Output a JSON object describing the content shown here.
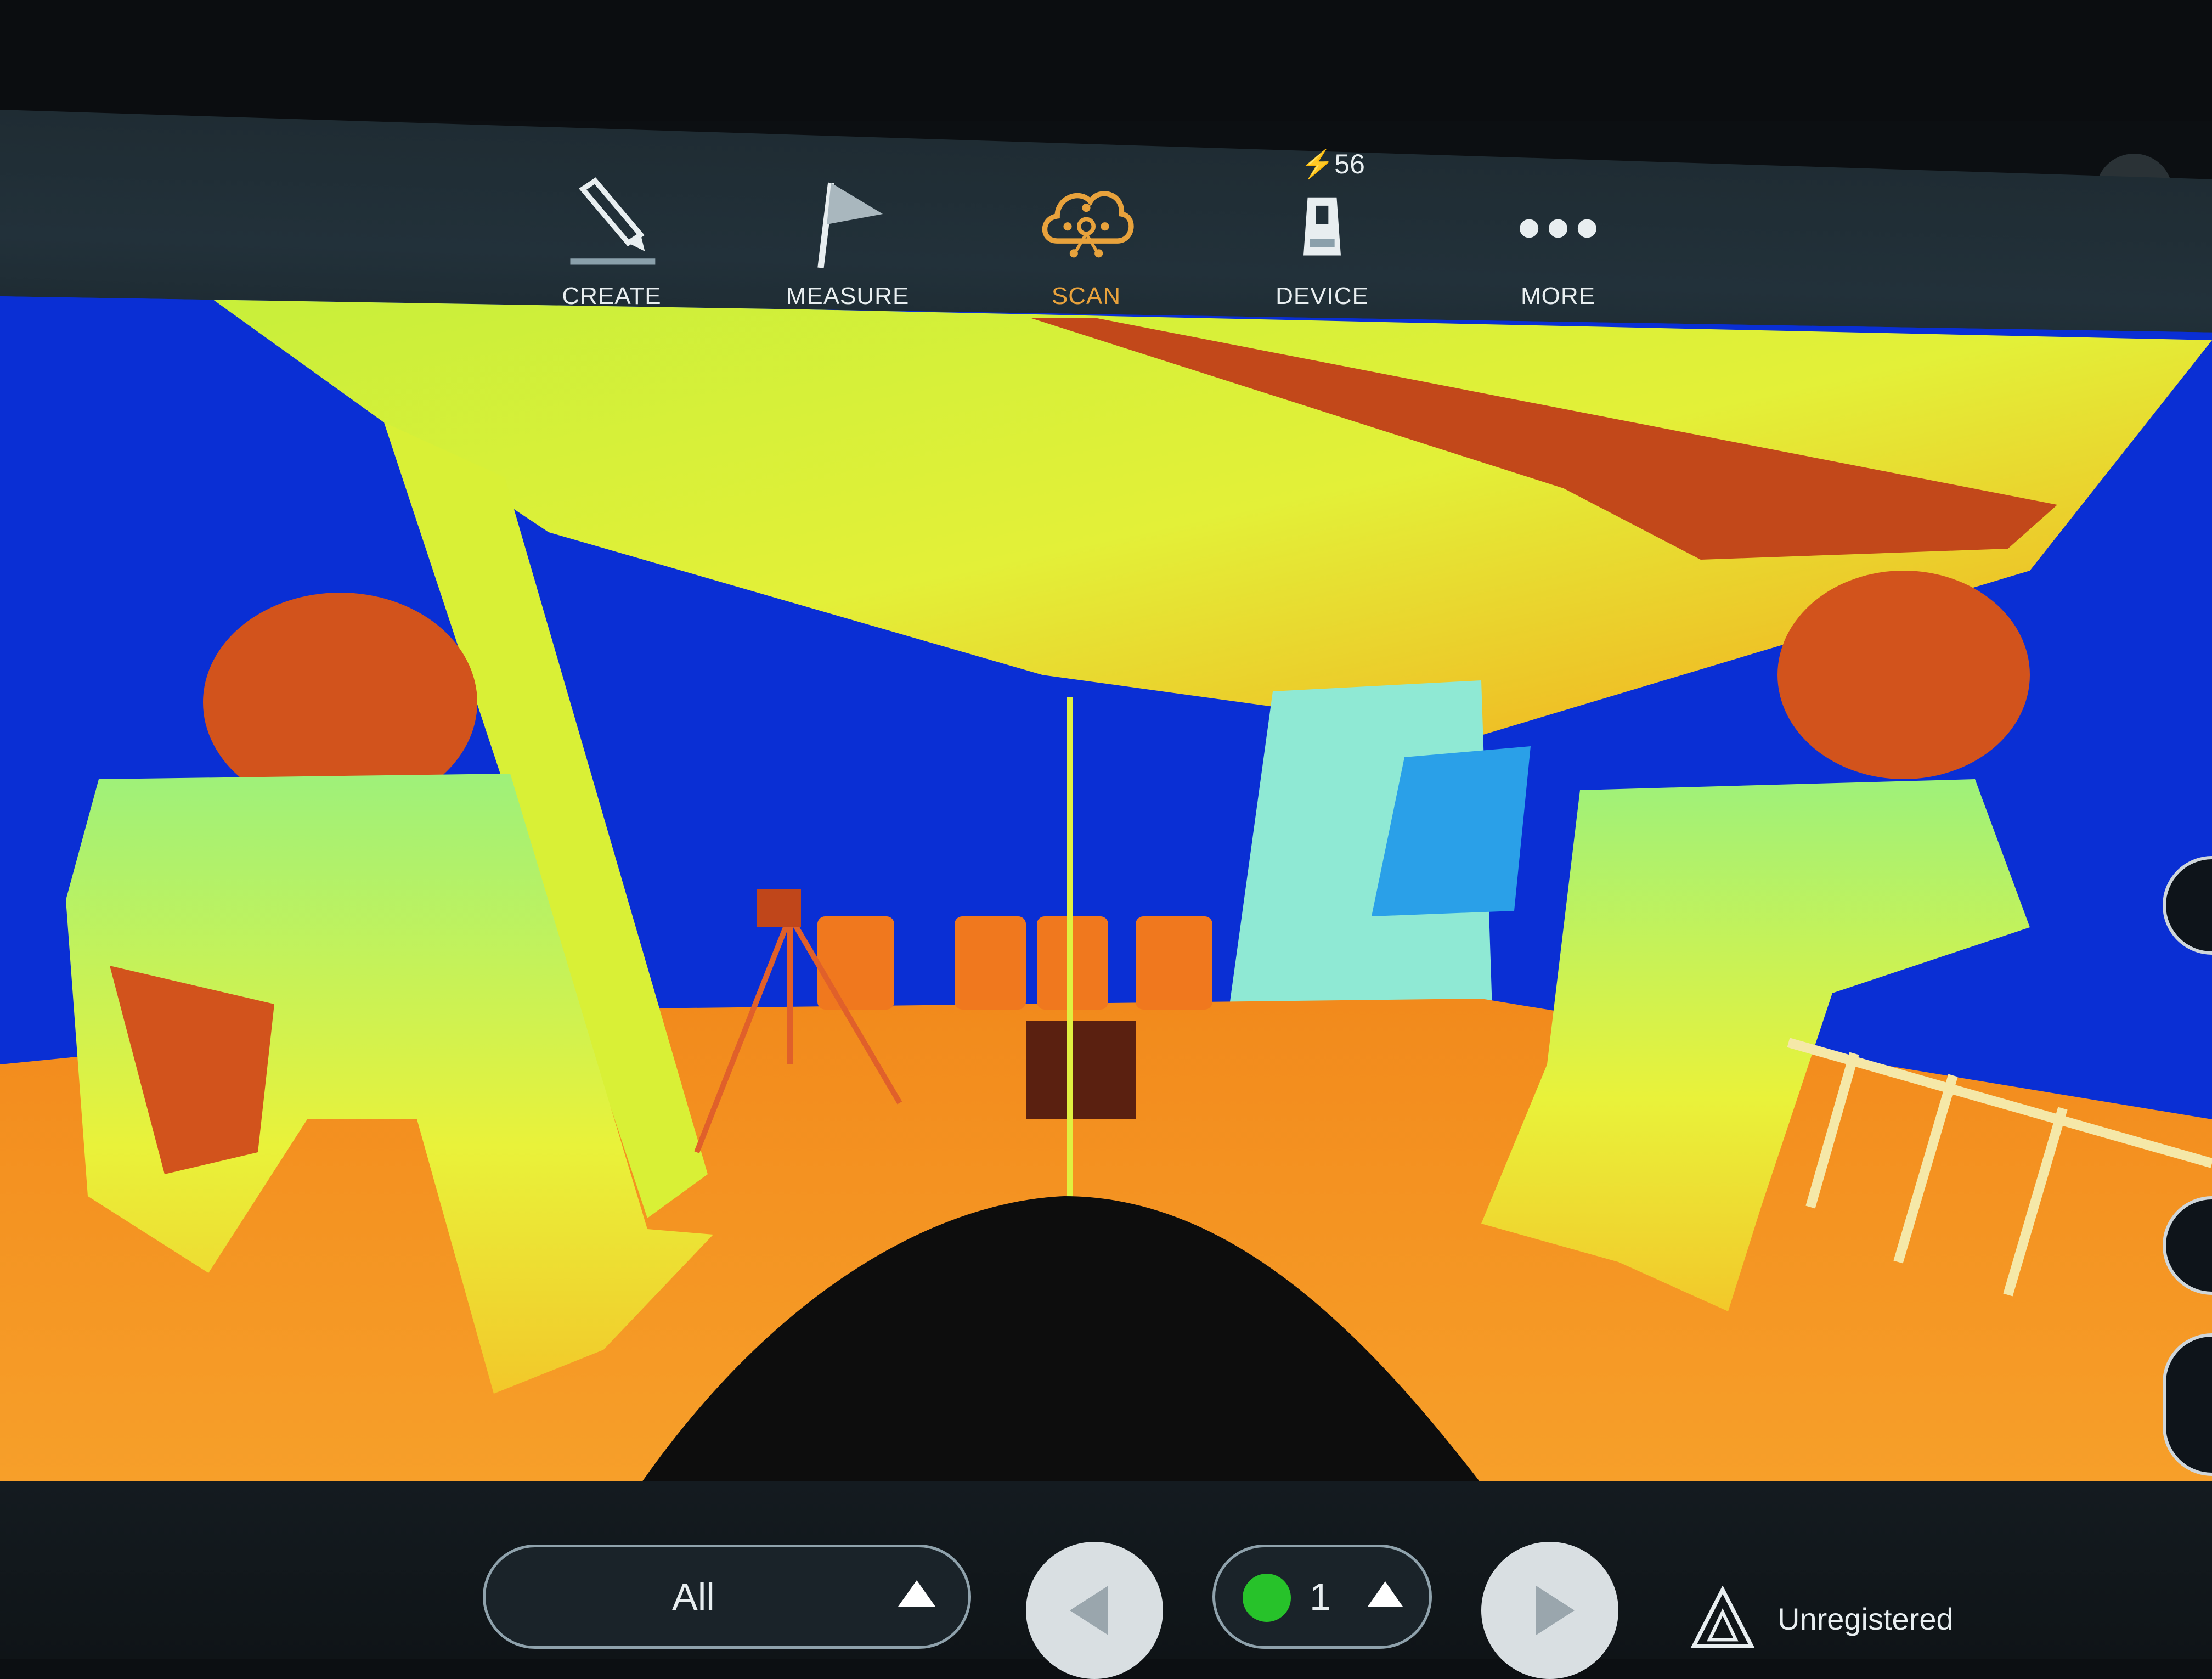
{
  "toolbar": {
    "items": [
      {
        "label": "CREATE",
        "icon": "pencil-icon"
      },
      {
        "label": "MEASURE",
        "icon": "flag-icon"
      },
      {
        "label": "SCAN",
        "icon": "cloud-scan-icon",
        "active": true
      },
      {
        "label": "DEVICE",
        "icon": "scanner-device-icon",
        "battery": "56"
      },
      {
        "label": "MORE",
        "icon": "more-dots-icon"
      }
    ],
    "active_color": "#e8a23c"
  },
  "bottom": {
    "filter_value": "All",
    "count_value": "1",
    "status_text": "Unregistered",
    "status_dot_color": "#27c22a"
  }
}
